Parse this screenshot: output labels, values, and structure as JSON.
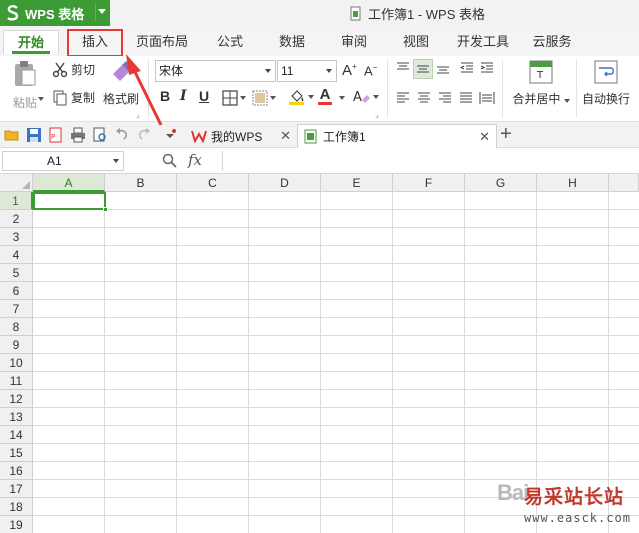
{
  "app": {
    "name": "WPS 表格",
    "window_title": "工作簿1 - WPS 表格",
    "accent": "#3d9b35"
  },
  "menu": {
    "tabs": [
      {
        "label": "开始",
        "active": true
      },
      {
        "label": "插入",
        "highlighted": true
      },
      {
        "label": "页面布局"
      },
      {
        "label": "公式"
      },
      {
        "label": "数据"
      },
      {
        "label": "审阅"
      },
      {
        "label": "视图"
      },
      {
        "label": "开发工具"
      },
      {
        "label": "云服务"
      }
    ]
  },
  "ribbon": {
    "paste_label": "粘贴",
    "cut_label": "剪切",
    "copy_label": "复制",
    "format_painter_label": "格式刷",
    "font_name": "宋体",
    "font_size": "11",
    "bold_label": "B",
    "italic_label": "I",
    "underline_label": "U",
    "font_color_label": "A",
    "merge_center_label": "合并居中",
    "wrap_text_label": "自动换行"
  },
  "doc_tabs": [
    {
      "label": "我的WPS"
    },
    {
      "label": "工作簿1",
      "active": true
    }
  ],
  "formula_bar": {
    "name_box": "A1",
    "fx_label": "fx",
    "formula": ""
  },
  "sheet": {
    "columns": [
      "A",
      "B",
      "C",
      "D",
      "E",
      "F",
      "G",
      "H"
    ],
    "rows": [
      "1",
      "2",
      "3",
      "4",
      "5",
      "6",
      "7",
      "8",
      "9",
      "10",
      "11",
      "12",
      "13",
      "14",
      "15",
      "16",
      "17",
      "18",
      "19"
    ],
    "active_cell": "A1"
  },
  "watermark": {
    "brand": "Bai",
    "site_name": "易采站长站",
    "url": "www.easck.com"
  },
  "icons": [
    "wps-logo-icon",
    "document-icon",
    "paste-icon",
    "scissors-icon",
    "copy-icon",
    "format-painter-icon",
    "grow-font-icon",
    "shrink-font-icon",
    "borders-icon",
    "fill-color-icon",
    "align-icon",
    "merge-icon",
    "wrap-icon",
    "open-icon",
    "save-icon",
    "pdf-icon",
    "print-icon",
    "undo-icon",
    "redo-icon",
    "zoom-icon"
  ]
}
